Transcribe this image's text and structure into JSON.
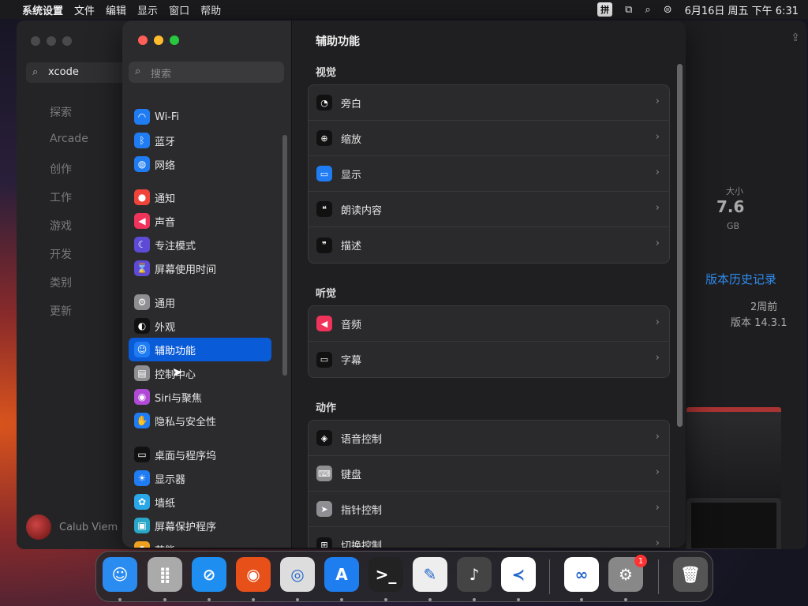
{
  "menubar": {
    "apple": "",
    "app": "系统设置",
    "items": [
      "文件",
      "编辑",
      "显示",
      "窗口",
      "帮助"
    ],
    "ime": "拼",
    "datetime": "6月16日 周五  下午 6:31"
  },
  "appstore": {
    "search_value": "xcode",
    "nav": [
      "探索",
      "Arcade",
      "创作",
      "工作",
      "游戏",
      "开发",
      "类别",
      "更新"
    ],
    "user": "Calub Viem",
    "size_label": "大小",
    "size_value": "7.6",
    "size_unit": "GB",
    "history_link": "版本历史记录",
    "weeks": "2周前",
    "version": "版本 14.3.1"
  },
  "settings": {
    "search_placeholder": "搜索",
    "sidebar": [
      {
        "label": "Wi-Fi",
        "icon": "wifi-icon",
        "color": "#1f7cf2",
        "glyph": "◠"
      },
      {
        "label": "蓝牙",
        "icon": "bluetooth-icon",
        "color": "#1f7cf2",
        "glyph": "ᛒ"
      },
      {
        "label": "网络",
        "icon": "globe-icon",
        "color": "#1f7cf2",
        "glyph": "◍"
      },
      {
        "label": "通知",
        "icon": "bell-icon",
        "color": "#f0433a",
        "glyph": "●"
      },
      {
        "label": "声音",
        "icon": "speaker-icon",
        "color": "#f0335a",
        "glyph": "◀"
      },
      {
        "label": "专注模式",
        "icon": "moon-icon",
        "color": "#5d4ad6",
        "glyph": "☾"
      },
      {
        "label": "屏幕使用时间",
        "icon": "hourglass-icon",
        "color": "#5d4ad6",
        "glyph": "⌛"
      },
      {
        "label": "通用",
        "icon": "gear-icon",
        "color": "#8e8e93",
        "glyph": "⚙"
      },
      {
        "label": "外观",
        "icon": "appearance-icon",
        "color": "#111111",
        "glyph": "◐"
      },
      {
        "label": "辅助功能",
        "icon": "accessibility-icon",
        "color": "#1f7cf2",
        "glyph": "☺"
      },
      {
        "label": "控制中心",
        "icon": "control-center-icon",
        "color": "#8e8e93",
        "glyph": "▤"
      },
      {
        "label": "Siri与聚焦",
        "icon": "siri-icon",
        "color": "#b04ad6",
        "glyph": "◉"
      },
      {
        "label": "隐私与安全性",
        "icon": "hand-icon",
        "color": "#1f7cf2",
        "glyph": "✋"
      },
      {
        "label": "桌面与程序坞",
        "icon": "dock-icon",
        "color": "#111111",
        "glyph": "▭"
      },
      {
        "label": "显示器",
        "icon": "brightness-icon",
        "color": "#1f7cf2",
        "glyph": "☀"
      },
      {
        "label": "墙纸",
        "icon": "wallpaper-icon",
        "color": "#2aa7e8",
        "glyph": "✿"
      },
      {
        "label": "屏幕保护程序",
        "icon": "screensaver-icon",
        "color": "#2aa7c8",
        "glyph": "▣"
      },
      {
        "label": "节能",
        "icon": "battery-icon",
        "color": "#f0a020",
        "glyph": "▮"
      }
    ],
    "title": "辅助功能",
    "sections": [
      {
        "title": "视觉",
        "rows": [
          {
            "label": "旁白",
            "icon": "voiceover-icon",
            "color": "#111111",
            "glyph": "◔"
          },
          {
            "label": "缩放",
            "icon": "zoom-icon",
            "color": "#111111",
            "glyph": "⊕"
          },
          {
            "label": "显示",
            "icon": "display-icon",
            "color": "#1f7cf2",
            "glyph": "▭"
          },
          {
            "label": "朗读内容",
            "icon": "spoken-content-icon",
            "color": "#111111",
            "glyph": "❝"
          },
          {
            "label": "描述",
            "icon": "descriptions-icon",
            "color": "#111111",
            "glyph": "❞"
          }
        ]
      },
      {
        "title": "听觉",
        "rows": [
          {
            "label": "音频",
            "icon": "audio-icon",
            "color": "#f0335a",
            "glyph": "◀"
          },
          {
            "label": "字幕",
            "icon": "captions-icon",
            "color": "#111111",
            "glyph": "▭"
          }
        ]
      },
      {
        "title": "动作",
        "rows": [
          {
            "label": "语音控制",
            "icon": "voice-control-icon",
            "color": "#111111",
            "glyph": "◈"
          },
          {
            "label": "键盘",
            "icon": "keyboard-icon",
            "color": "#8e8e93",
            "glyph": "⌨"
          },
          {
            "label": "指针控制",
            "icon": "pointer-icon",
            "color": "#8e8e93",
            "glyph": "➤"
          },
          {
            "label": "切换控制",
            "icon": "switch-control-icon",
            "color": "#111111",
            "glyph": "⊞"
          }
        ]
      }
    ]
  },
  "dock": {
    "badge": "1",
    "apps": [
      {
        "name": "finder-icon",
        "color": "#2a8cf0",
        "glyph": "☺"
      },
      {
        "name": "launchpad-icon",
        "color": "#aaaaaa",
        "glyph": "⣿"
      },
      {
        "name": "safari-icon",
        "color": "#1e8ef0",
        "glyph": "⊘"
      },
      {
        "name": "firefox-icon",
        "color": "#e8501a",
        "glyph": "◉"
      },
      {
        "name": "chrome-icon",
        "color": "#dddddd",
        "glyph": "◎"
      },
      {
        "name": "app-store-icon",
        "color": "#1e7ef0",
        "glyph": "A"
      },
      {
        "name": "terminal-icon",
        "color": "#222222",
        "glyph": ">_"
      },
      {
        "name": "textedit-icon",
        "color": "#eeeeee",
        "glyph": "✎"
      },
      {
        "name": "garageband-icon",
        "color": "#444444",
        "glyph": "♪"
      },
      {
        "name": "vscode-icon",
        "color": "#ffffff",
        "glyph": "≺"
      },
      {
        "name": "visual-studio-icon",
        "color": "#ffffff",
        "glyph": "∞"
      },
      {
        "name": "system-settings-icon",
        "color": "#888888",
        "glyph": "⚙"
      },
      {
        "name": "trash-icon",
        "color": "#555555",
        "glyph": "🗑"
      }
    ]
  }
}
